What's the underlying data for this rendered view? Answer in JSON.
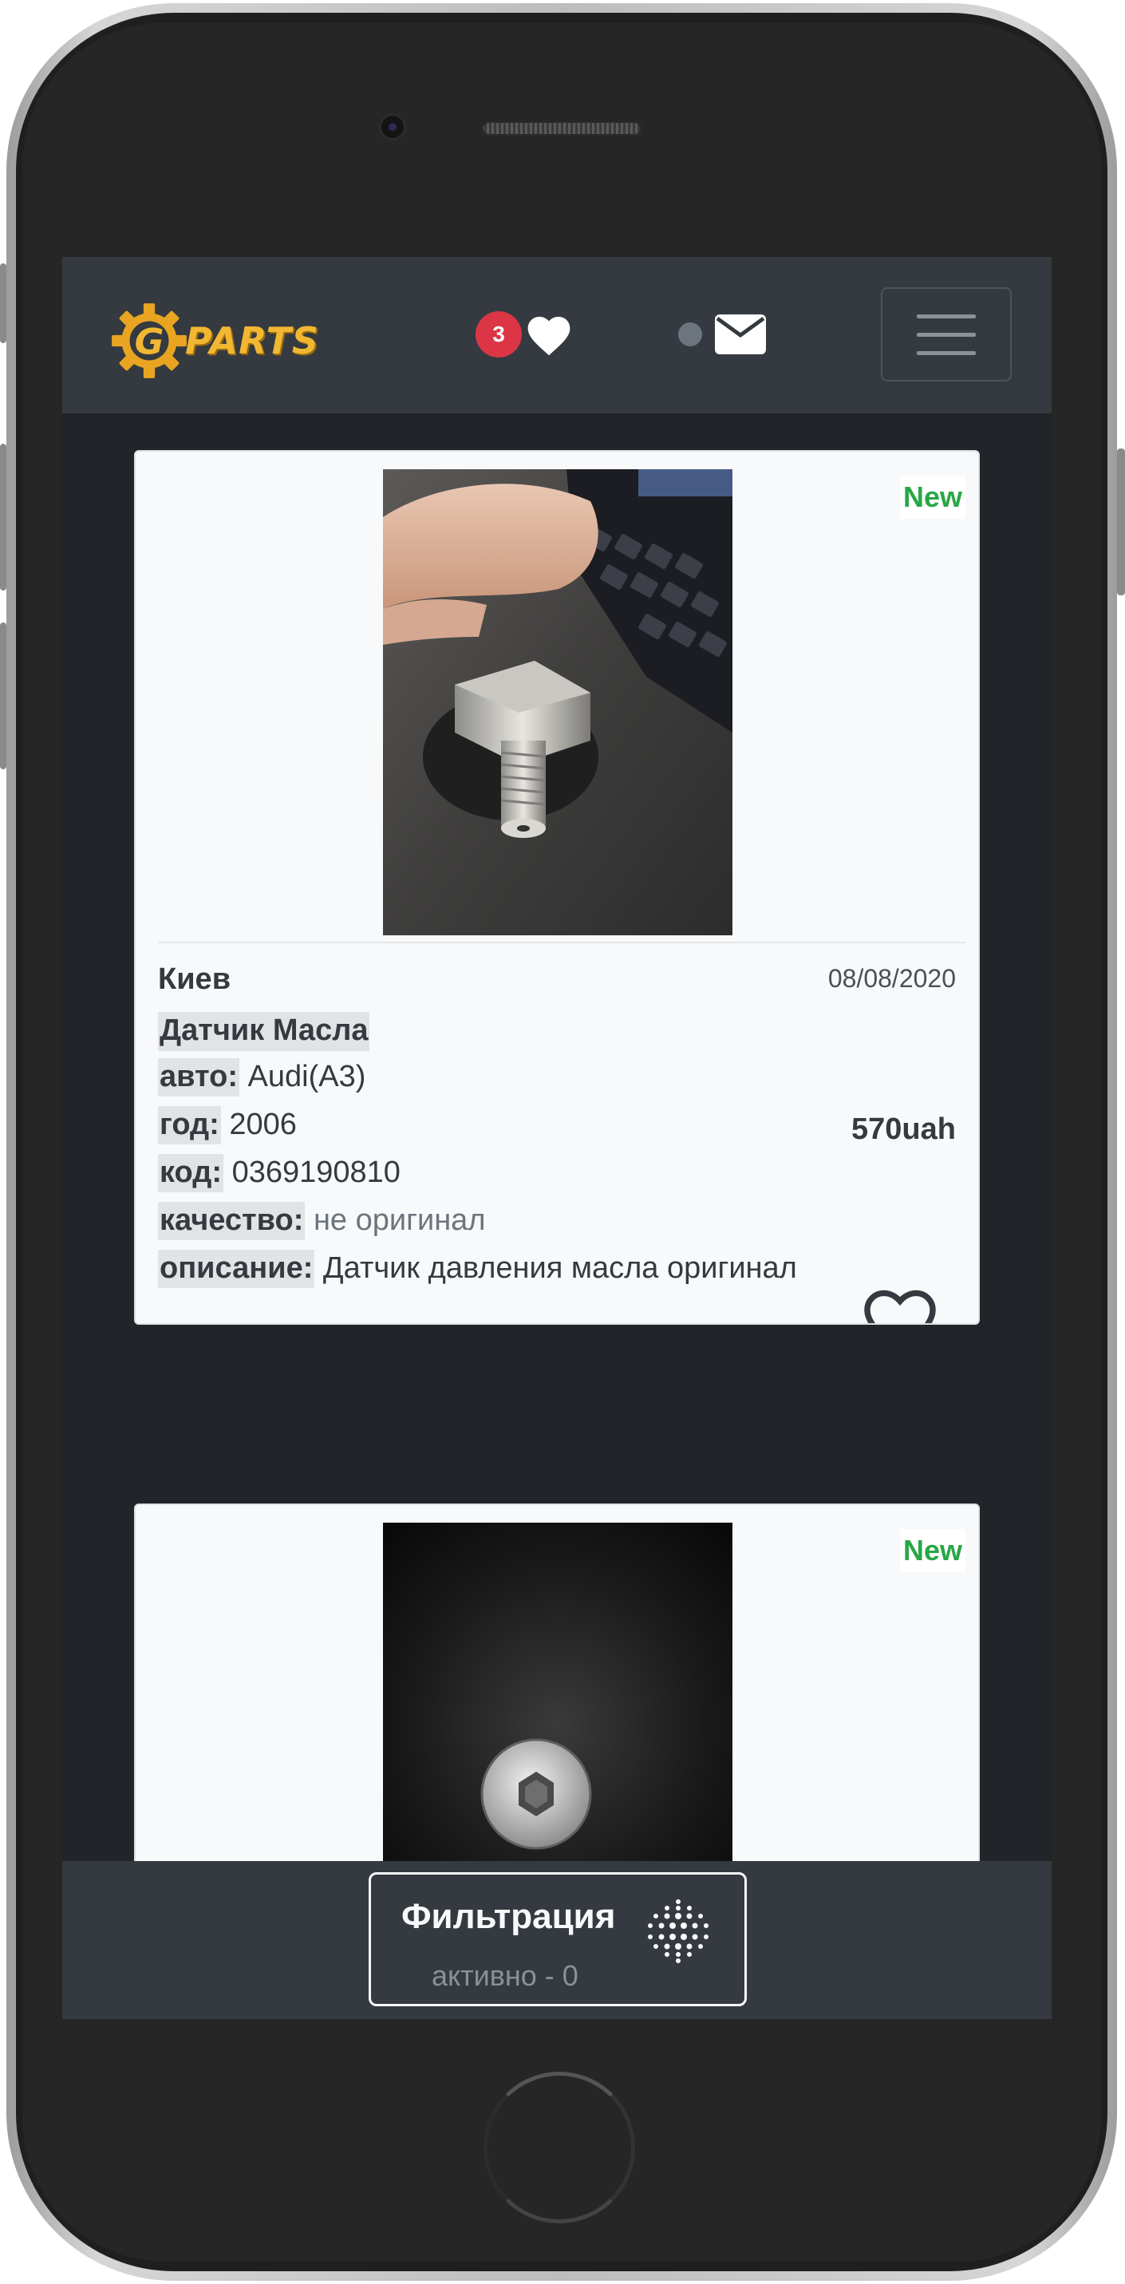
{
  "header": {
    "logo_text": "PARTS",
    "logo_letter": "G",
    "favorites_count": "3",
    "icons": [
      "heart-icon",
      "envelope-icon",
      "hamburger-menu-icon"
    ]
  },
  "listings": [
    {
      "status": "New",
      "city": "Киев",
      "date": "08/08/2020",
      "title": "Датчик Масла",
      "car_label": "авто:",
      "car_value": "Audi(A3)",
      "year_label": "год:",
      "year_value": "2006",
      "price": "570uah",
      "code_label": "код:",
      "code_value": "0369190810",
      "quality_label": "качество:",
      "quality_value": "не оригинал",
      "description_label": "описание:",
      "description_value": "Датчик давления масла оригинал"
    },
    {
      "status": "New"
    }
  ],
  "filter": {
    "title": "Фильтрация",
    "subtitle": "активно - 0"
  },
  "colors": {
    "navbar": "#343a40",
    "background": "#212529",
    "card": "#f8f9fa",
    "badge": "#dc3545",
    "new_label": "#28a745",
    "logo": "#f2b732"
  }
}
